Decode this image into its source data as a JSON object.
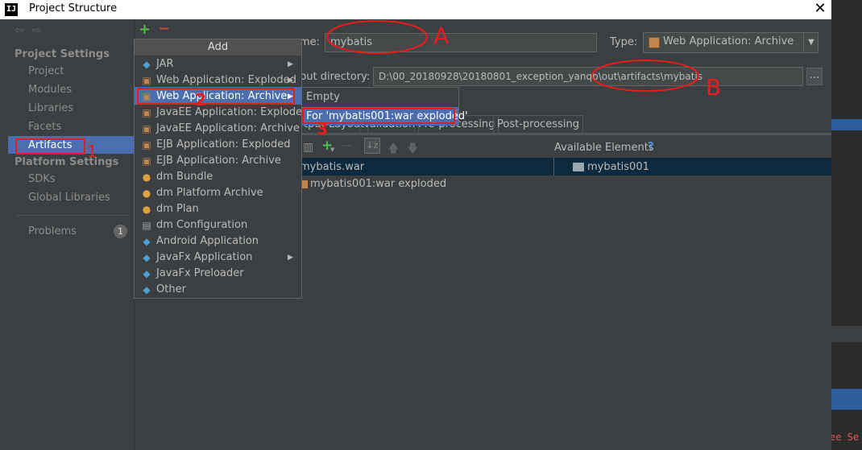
{
  "window": {
    "title": "Project Structure",
    "logo": "IJ",
    "close": "✕"
  },
  "sidebar": {
    "back": "⇦",
    "forward": "⇨",
    "project_settings": "Project Settings",
    "items": [
      "Project",
      "Modules",
      "Libraries",
      "Facets",
      "Artifacts"
    ],
    "platform_settings": "Platform Settings",
    "platform_items": [
      "SDKs",
      "Global Libraries"
    ],
    "problems": "Problems",
    "problems_count": "1"
  },
  "toolbar": {
    "add": "+",
    "remove": "−"
  },
  "form": {
    "name_label": "me:",
    "name_value": "mybatis",
    "type_label": "Type:",
    "type_value": "Web Application: Archive",
    "output_label": "put directory:",
    "output_value": "D:\\00_20180928\\20180801_exception_yanqb\\out\\artifacts\\mybatis",
    "browse": "…"
  },
  "tabs": [
    "tput Layout",
    "Validation",
    "Pre-processing",
    "Post-processing"
  ],
  "layout": {
    "available_elements": "Available Elements",
    "help": "?",
    "tree": [
      "mybatis.war",
      "mybatis001:war exploded"
    ],
    "available": [
      "mybatis001"
    ]
  },
  "add_menu": {
    "header": "Add",
    "items": [
      {
        "label": "JAR",
        "icon": "◆",
        "sub": true
      },
      {
        "label": "Web Application: Exploded",
        "icon": "▣",
        "sub": true
      },
      {
        "label": "Web Application: Archive",
        "icon": "▣",
        "sub": true
      },
      {
        "label": "JavaEE Application: Exploded",
        "icon": "▣",
        "sub": false
      },
      {
        "label": "JavaEE Application: Archive",
        "icon": "▣",
        "sub": false
      },
      {
        "label": "EJB Application: Exploded",
        "icon": "▣",
        "sub": false
      },
      {
        "label": "EJB Application: Archive",
        "icon": "▣",
        "sub": false
      },
      {
        "label": "dm Bundle",
        "icon": "●",
        "sub": false
      },
      {
        "label": "dm Platform Archive",
        "icon": "●",
        "sub": false
      },
      {
        "label": "dm Plan",
        "icon": "●",
        "sub": false
      },
      {
        "label": "dm Configuration",
        "icon": "▤",
        "sub": false
      },
      {
        "label": "Android Application",
        "icon": "◆",
        "sub": false
      },
      {
        "label": "JavaFx Application",
        "icon": "◆",
        "sub": true
      },
      {
        "label": "JavaFx Preloader",
        "icon": "◆",
        "sub": false
      },
      {
        "label": "Other",
        "icon": "◆",
        "sub": false
      }
    ]
  },
  "submenu": {
    "items": [
      "Empty",
      "For 'mybatis001:war exploded'"
    ]
  },
  "annotations": {
    "a": "A",
    "b": "B",
    "n1": "1",
    "n2": "2",
    "n3": "3"
  },
  "background": {
    "edge_text": "ee Se"
  },
  "colors": {
    "selection": "#4b6eaf",
    "annotation": "#e81c1c",
    "add": "#4fbf4f",
    "remove": "#cc4444"
  },
  "icons": [
    "back-arrow-icon",
    "forward-arrow-icon",
    "add-icon",
    "remove-icon",
    "folder-icon",
    "archive-icon",
    "help-icon",
    "dropdown-arrow-icon",
    "submenu-arrow-icon"
  ]
}
